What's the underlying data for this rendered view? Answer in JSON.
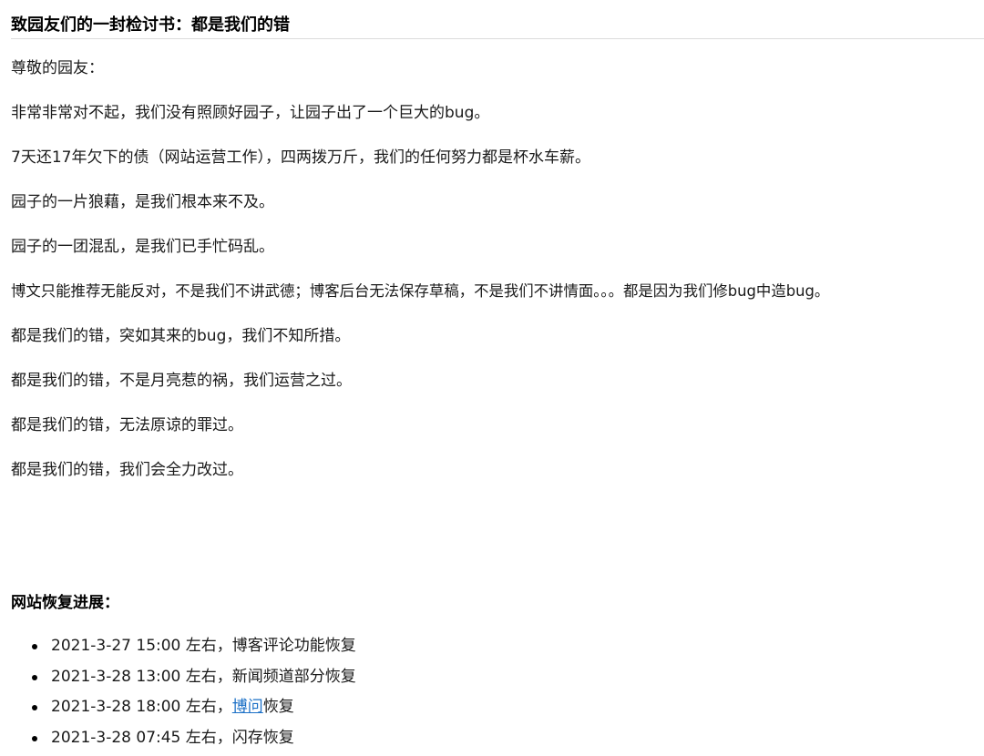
{
  "title": "致园友们的一封检讨书：都是我们的错",
  "paragraphs": [
    "尊敬的园友：",
    "非常非常对不起，我们没有照顾好园子，让园子出了一个巨大的bug。",
    "7天还17年欠下的债（网站运营工作），四两拨万斤，我们的任何努力都是杯水车薪。",
    "园子的一片狼藉，是我们根本来不及。",
    "园子的一团混乱，是我们已手忙码乱。",
    "博文只能推荐无能反对，不是我们不讲武德；博客后台无法保存草稿，不是我们不讲情面。。。都是因为我们修bug中造bug。",
    "都是我们的错，突如其来的bug，我们不知所措。",
    "都是我们的错，不是月亮惹的祸，我们运营之过。",
    "都是我们的错，无法原谅的罪过。",
    "都是我们的错，我们会全力改过。"
  ],
  "progress": {
    "title": "网站恢复进展：",
    "items": [
      {
        "prefix": "2021-3-27 15:00 左右，",
        "text": "博客评论功能恢复",
        "link": "",
        "suffix": ""
      },
      {
        "prefix": "2021-3-28 13:00 左右，",
        "text": "新闻频道部分恢复",
        "link": "",
        "suffix": ""
      },
      {
        "prefix": "2021-3-28 18:00 左右，",
        "text": "",
        "link": "博问",
        "suffix": "恢复"
      },
      {
        "prefix": "2021-3-28 07:45 左右，",
        "text": "闪存恢复",
        "link": "",
        "suffix": ""
      }
    ]
  },
  "colors": {
    "text": "#1a1a1a",
    "link": "#1a6fc6",
    "divider": "#dcdcdc"
  }
}
